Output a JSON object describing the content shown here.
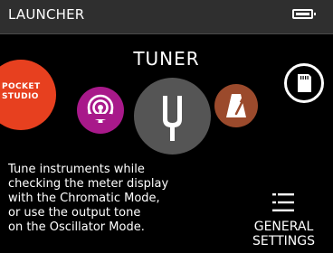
{
  "status_bar": {
    "title": "LAUNCHER",
    "battery_icon": "battery-icon",
    "battery_level": 1.0
  },
  "main": {
    "title": "TUNER",
    "apps": [
      {
        "name": "pocketstudio",
        "icon": "pocketstudio-logo-icon",
        "label": "POCKET\nSTUDIO",
        "color": "#e7401f"
      },
      {
        "name": "podcast",
        "icon": "podcast-icon",
        "color": "#a8198a"
      },
      {
        "name": "tuner",
        "icon": "tuning-fork-icon",
        "color": "#555555",
        "selected": true
      },
      {
        "name": "metronome",
        "icon": "metronome-icon",
        "color": "#9b4a2c"
      },
      {
        "name": "sd-card",
        "icon": "sd-card-icon",
        "color": "#000000"
      }
    ],
    "description": "Tune instruments while\nchecking the meter display\nwith the Chromatic Mode,\nor use the output tone\non the Oscillator Mode."
  },
  "settings": {
    "icon": "list-icon",
    "label": "GENERAL\nSETTINGS"
  }
}
